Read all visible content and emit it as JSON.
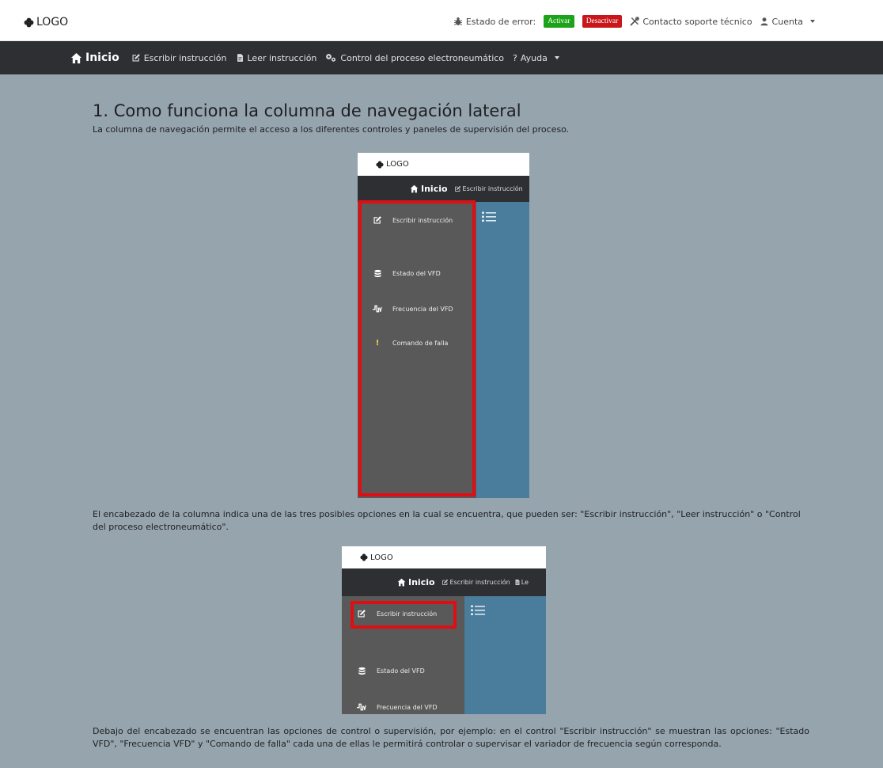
{
  "header": {
    "logo": "LOGO",
    "error_state_label": "Estado de error:",
    "activate_label": "Activar",
    "deactivate_label": "Desactivar",
    "support_label": "Contacto soporte técnico",
    "account_label": "Cuenta"
  },
  "nav": {
    "home": "Inicio",
    "write": "Escribir instrucción",
    "read": "Leer instrucción",
    "control": "Control del proceso electroneumático",
    "help": "Ayuda"
  },
  "content": {
    "title": "1. Como funciona la columna de navegación lateral",
    "intro": "La columna de navegación permite el acceso a los diferentes controles y paneles de supervisión del proceso.",
    "para2": "El encabezado de la columna indica una de las tres posibles opciones en la cual se encuentra, que pueden ser: \"Escribir instrucción\", \"Leer instrucción\" o \"Control del proceso electroneumático\".",
    "para3": "Debajo del encabezado se encuentran las opciones de control o supervisión, por ejemplo: en el control \"Escribir instrucción\" se muestran las opciones: \"Estado VFD\", \"Frecuencia VFD\" y \"Comando de falla\" cada una de ellas le permitirá controlar o supervisar el variador de frecuencia según corresponda."
  },
  "mockup1": {
    "logo": "LOGO",
    "home": "Inicio",
    "nav_write": "Escribir instrucción",
    "items": [
      "Escribir instrucción",
      "Estado del VFD",
      "Frecuencia del VFD",
      "Comando de falla"
    ]
  },
  "mockup2": {
    "logo": "LOGO",
    "home": "Inicio",
    "nav_write": "Escribir instrucción",
    "nav_read": "Le",
    "items": [
      "Escribir instrucción",
      "Estado del VFD",
      "Frecuencia del VFD"
    ]
  },
  "colors": {
    "page_bg": "#96a4ad",
    "navbar": "#2d2f33",
    "activate": "#1ca319",
    "deactivate": "#c8161b",
    "sidebar": "#595959",
    "main_panel": "#4a7c9b",
    "highlight": "#e00e12"
  }
}
